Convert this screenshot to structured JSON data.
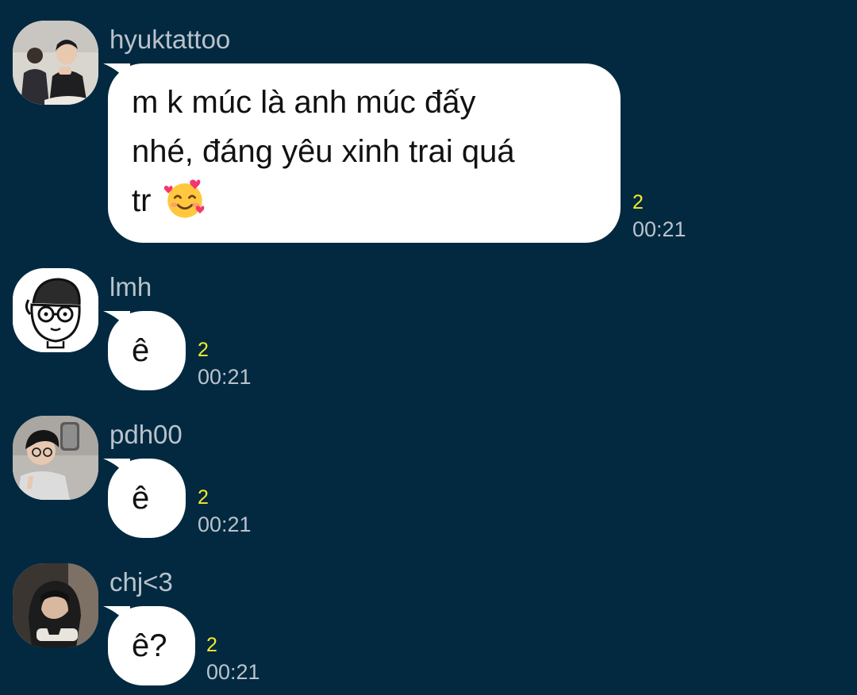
{
  "theme": {
    "background": "#022940",
    "bubble": "#ffffff",
    "unread_count_color": "#f4ea2a",
    "meta_color": "#b9c3cb"
  },
  "messages": [
    {
      "sender": "hyuktattoo",
      "text_lines": [
        "m k múc là anh múc đấy",
        "nhé, đáng yêu xinh trai quá",
        "tr"
      ],
      "emoji": "smiling-face-with-hearts",
      "unread": "2",
      "time": "00:21"
    },
    {
      "sender": "lmh",
      "text": "ê",
      "unread": "2",
      "time": "00:21"
    },
    {
      "sender": "pdh00",
      "text": "ê",
      "unread": "2",
      "time": "00:21"
    },
    {
      "sender": "chj<3",
      "text": "ê?",
      "unread": "2",
      "time": "00:21"
    }
  ]
}
